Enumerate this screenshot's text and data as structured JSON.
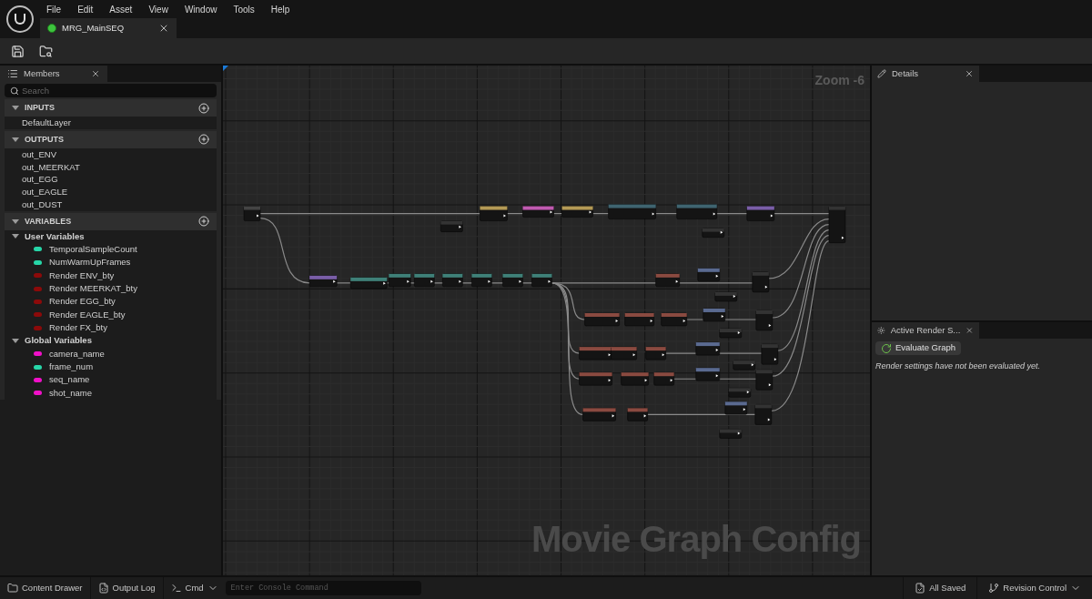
{
  "menu": [
    "File",
    "Edit",
    "Asset",
    "View",
    "Window",
    "Tools",
    "Help"
  ],
  "document_tab": {
    "title": "MRG_MainSEQ",
    "selected": true
  },
  "members_panel": {
    "tab": "Members",
    "search": {
      "placeholder": "Search"
    },
    "sections": [
      {
        "title": "INPUTS",
        "expanded": true,
        "items": [
          {
            "label": "DefaultLayer"
          }
        ]
      },
      {
        "title": "OUTPUTS",
        "expanded": true,
        "items": [
          {
            "label": "out_ENV"
          },
          {
            "label": "out_MEERKAT"
          },
          {
            "label": "out_EGG"
          },
          {
            "label": "out_EAGLE"
          },
          {
            "label": "out_DUST"
          }
        ]
      },
      {
        "title": "VARIABLES",
        "expanded": true,
        "groups": [
          {
            "title": "User Variables",
            "expanded": true,
            "items": [
              {
                "label": "TemporalSampleCount",
                "color": "#27d6a8"
              },
              {
                "label": "NumWarmUpFrames",
                "color": "#27d6a8"
              },
              {
                "label": "Render ENV_bty",
                "color": "#8c0a0a"
              },
              {
                "label": "Render MEERKAT_bty",
                "color": "#8c0a0a"
              },
              {
                "label": "Render EGG_bty",
                "color": "#8c0a0a"
              },
              {
                "label": "Render EAGLE_bty",
                "color": "#8c0a0a"
              },
              {
                "label": "Render FX_bty",
                "color": "#8c0a0a"
              }
            ]
          },
          {
            "title": "Global Variables",
            "expanded": true,
            "items": [
              {
                "label": "camera_name",
                "color": "#f010c8"
              },
              {
                "label": "frame_num",
                "color": "#27d6a8"
              },
              {
                "label": "seq_name",
                "color": "#f010c8"
              },
              {
                "label": "shot_name",
                "color": "#f010c8"
              }
            ]
          }
        ]
      }
    ]
  },
  "graph": {
    "zoom": "Zoom -6",
    "caption": "Movie Graph Config"
  },
  "details_panel": {
    "tab": "Details"
  },
  "render_panel": {
    "tab": "Active Render S...",
    "button": "Evaluate Graph",
    "message": "Render settings have not been evaluated yet."
  },
  "status_bar": {
    "content_drawer": "Content Drawer",
    "output_log": "Output Log",
    "cmd": "Cmd",
    "console": {
      "placeholder": "Enter Console Command"
    },
    "saved": "All Saved",
    "revision": "Revision Control"
  }
}
